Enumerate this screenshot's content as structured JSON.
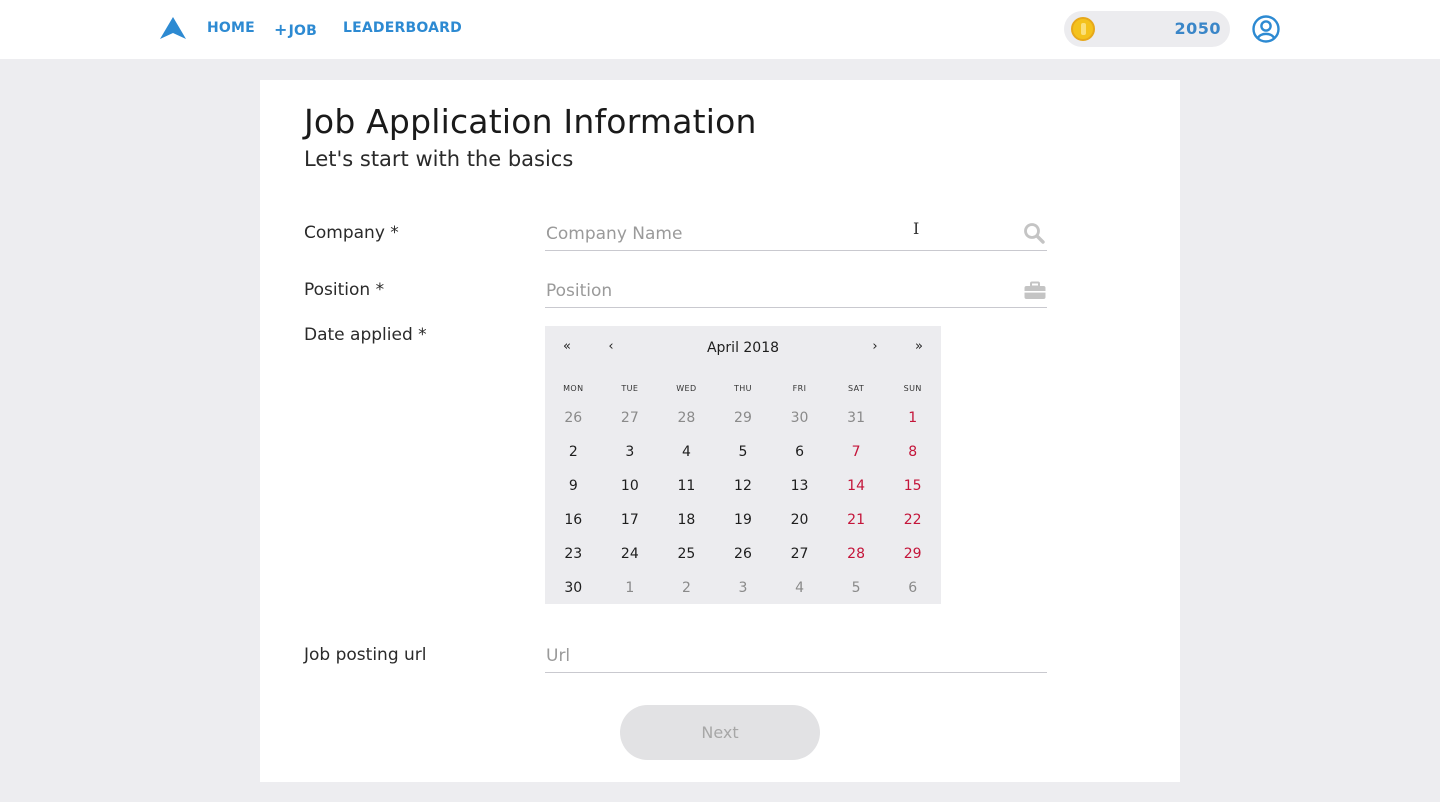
{
  "nav": {
    "home": "HOME",
    "job_plus": "+",
    "job": "JOB",
    "leaderboard": "LEADERBOARD",
    "coins": "2050",
    "accent": "#2d8ad2"
  },
  "form": {
    "title": "Job Application Information",
    "subtitle": "Let's start with the basics",
    "company_label": "Company *",
    "company_placeholder": "Company Name",
    "company_value": "",
    "position_label": "Position *",
    "position_placeholder": "Position",
    "position_value": "",
    "date_label": "Date applied *",
    "url_label": "Job posting url",
    "url_placeholder": "Url",
    "url_value": "",
    "next_label": "Next",
    "next_disabled": true
  },
  "calendar": {
    "month_label": "April 2018",
    "prev_year": "«",
    "prev_month": "‹",
    "next_month": "›",
    "next_year": "»",
    "weekdays": [
      "MON",
      "TUE",
      "WED",
      "THU",
      "FRI",
      "SAT",
      "SUN"
    ],
    "weeks": [
      [
        {
          "d": "26",
          "out": true
        },
        {
          "d": "27",
          "out": true
        },
        {
          "d": "28",
          "out": true
        },
        {
          "d": "29",
          "out": true
        },
        {
          "d": "30",
          "out": true
        },
        {
          "d": "31",
          "out": true
        },
        {
          "d": "1",
          "out": false
        }
      ],
      [
        {
          "d": "2",
          "out": false
        },
        {
          "d": "3",
          "out": false
        },
        {
          "d": "4",
          "out": false
        },
        {
          "d": "5",
          "out": false
        },
        {
          "d": "6",
          "out": false
        },
        {
          "d": "7",
          "out": false
        },
        {
          "d": "8",
          "out": false
        }
      ],
      [
        {
          "d": "9",
          "out": false
        },
        {
          "d": "10",
          "out": false
        },
        {
          "d": "11",
          "out": false
        },
        {
          "d": "12",
          "out": false
        },
        {
          "d": "13",
          "out": false
        },
        {
          "d": "14",
          "out": false
        },
        {
          "d": "15",
          "out": false
        }
      ],
      [
        {
          "d": "16",
          "out": false
        },
        {
          "d": "17",
          "out": false
        },
        {
          "d": "18",
          "out": false
        },
        {
          "d": "19",
          "out": false
        },
        {
          "d": "20",
          "out": false
        },
        {
          "d": "21",
          "out": false
        },
        {
          "d": "22",
          "out": false
        }
      ],
      [
        {
          "d": "23",
          "out": false
        },
        {
          "d": "24",
          "out": false
        },
        {
          "d": "25",
          "out": false
        },
        {
          "d": "26",
          "out": false
        },
        {
          "d": "27",
          "out": false
        },
        {
          "d": "28",
          "out": false
        },
        {
          "d": "29",
          "out": false
        }
      ],
      [
        {
          "d": "30",
          "out": false
        },
        {
          "d": "1",
          "out": true
        },
        {
          "d": "2",
          "out": true
        },
        {
          "d": "3",
          "out": true
        },
        {
          "d": "4",
          "out": true
        },
        {
          "d": "5",
          "out": true
        },
        {
          "d": "6",
          "out": true
        }
      ]
    ],
    "weekend_color": "#c4153a",
    "outside_color": "#8a8a8a"
  },
  "icons": {
    "logo": "arrow-up-logo",
    "coin": "coin-icon",
    "user": "user-circle-icon",
    "company_field": "search-icon",
    "position_field": "briefcase-icon"
  }
}
